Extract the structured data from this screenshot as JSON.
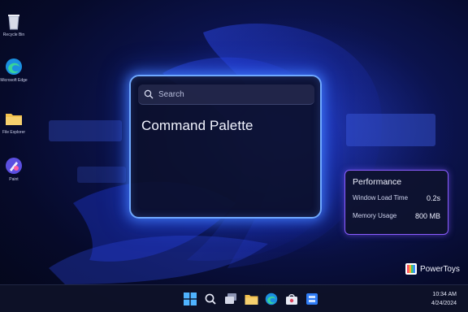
{
  "desktop": {
    "icons": [
      {
        "label": "Recycle Bin",
        "icon": "recycle-bin-icon"
      },
      {
        "label": "Microsoft Edge",
        "icon": "edge-icon"
      },
      {
        "label": "File Explorer",
        "icon": "folder-icon"
      },
      {
        "label": "Paint",
        "icon": "paint-icon"
      }
    ]
  },
  "command_palette": {
    "search_placeholder": "Search",
    "title": "Command Palette"
  },
  "performance": {
    "title": "Performance",
    "rows": [
      {
        "label": "Window Load Time",
        "value": "0.2s"
      },
      {
        "label": "Memory Usage",
        "value": "800 MB"
      }
    ]
  },
  "powertoys": {
    "label": "PowerToys"
  },
  "taskbar": {
    "icons": [
      "start-icon",
      "search-icon",
      "task-view-icon",
      "file-explorer-icon",
      "edge-icon",
      "store-icon",
      "app-icon"
    ],
    "time": "10:34 AM",
    "date": "4/24/2024"
  },
  "colors": {
    "accent": "#6fa8ff",
    "perf_border": "#8a5cff"
  }
}
